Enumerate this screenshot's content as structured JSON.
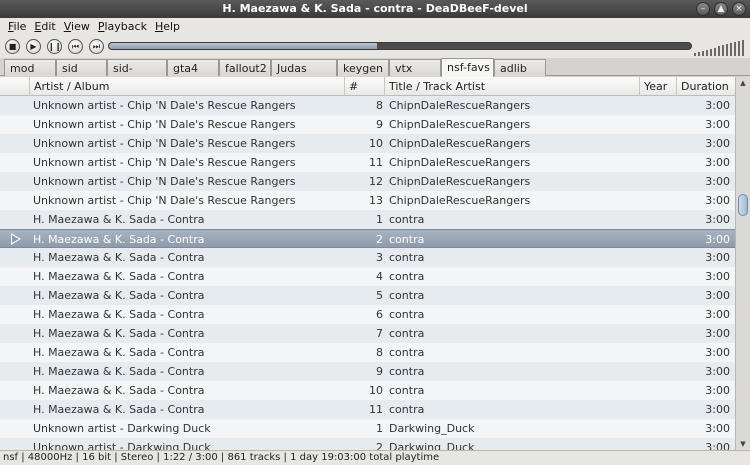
{
  "window": {
    "title": "H. Maezawa & K. Sada - contra - DeaDBeeF-devel"
  },
  "menu": [
    "File",
    "Edit",
    "View",
    "Playback",
    "Help"
  ],
  "seek": {
    "progress": 0.46
  },
  "tabs": [
    "mod",
    "sid",
    "sid-remake",
    "gta4",
    "fallout2",
    "Judas Priest",
    "keygen",
    "vtx",
    "nsf-favs",
    "adlib"
  ],
  "active_tab": "nsf-favs",
  "columns": {
    "artist": "Artist / Album",
    "num": "#",
    "title": "Title / Track Artist",
    "year": "Year",
    "duration": "Duration"
  },
  "rows": [
    {
      "artist": "Unknown artist - Chip 'N Dale's Rescue Rangers",
      "num": "8",
      "title": "ChipnDaleRescueRangers",
      "duration": "3:00"
    },
    {
      "artist": "Unknown artist - Chip 'N Dale's Rescue Rangers",
      "num": "9",
      "title": "ChipnDaleRescueRangers",
      "duration": "3:00"
    },
    {
      "artist": "Unknown artist - Chip 'N Dale's Rescue Rangers",
      "num": "10",
      "title": "ChipnDaleRescueRangers",
      "duration": "3:00"
    },
    {
      "artist": "Unknown artist - Chip 'N Dale's Rescue Rangers",
      "num": "11",
      "title": "ChipnDaleRescueRangers",
      "duration": "3:00"
    },
    {
      "artist": "Unknown artist - Chip 'N Dale's Rescue Rangers",
      "num": "12",
      "title": "ChipnDaleRescueRangers",
      "duration": "3:00"
    },
    {
      "artist": "Unknown artist - Chip 'N Dale's Rescue Rangers",
      "num": "13",
      "title": "ChipnDaleRescueRangers",
      "duration": "3:00"
    },
    {
      "artist": "H. Maezawa & K. Sada - Contra",
      "num": "1",
      "title": "contra",
      "duration": "3:00"
    },
    {
      "artist": "H. Maezawa & K. Sada - Contra",
      "num": "2",
      "title": "contra",
      "duration": "3:00",
      "selected": true
    },
    {
      "artist": "H. Maezawa & K. Sada - Contra",
      "num": "3",
      "title": "contra",
      "duration": "3:00"
    },
    {
      "artist": "H. Maezawa & K. Sada - Contra",
      "num": "4",
      "title": "contra",
      "duration": "3:00"
    },
    {
      "artist": "H. Maezawa & K. Sada - Contra",
      "num": "5",
      "title": "contra",
      "duration": "3:00"
    },
    {
      "artist": "H. Maezawa & K. Sada - Contra",
      "num": "6",
      "title": "contra",
      "duration": "3:00"
    },
    {
      "artist": "H. Maezawa & K. Sada - Contra",
      "num": "7",
      "title": "contra",
      "duration": "3:00"
    },
    {
      "artist": "H. Maezawa & K. Sada - Contra",
      "num": "8",
      "title": "contra",
      "duration": "3:00"
    },
    {
      "artist": "H. Maezawa & K. Sada - Contra",
      "num": "9",
      "title": "contra",
      "duration": "3:00"
    },
    {
      "artist": "H. Maezawa & K. Sada - Contra",
      "num": "10",
      "title": "contra",
      "duration": "3:00"
    },
    {
      "artist": "H. Maezawa & K. Sada - Contra",
      "num": "11",
      "title": "contra",
      "duration": "3:00"
    },
    {
      "artist": "Unknown artist - Darkwing Duck",
      "num": "1",
      "title": "Darkwing_Duck",
      "duration": "3:00"
    },
    {
      "artist": "Unknown artist - Darkwing Duck",
      "num": "2",
      "title": "Darkwing_Duck",
      "duration": "3:00"
    }
  ],
  "status": "nsf | 48000Hz | 16 bit | Stereo | 1:22 / 3:00 | 861 tracks | 1 day 19:03:00 total playtime",
  "colors": {
    "selection": "#8e9bab",
    "row_even": "#e6ebf0",
    "row_odd": "#f3f5f7"
  }
}
